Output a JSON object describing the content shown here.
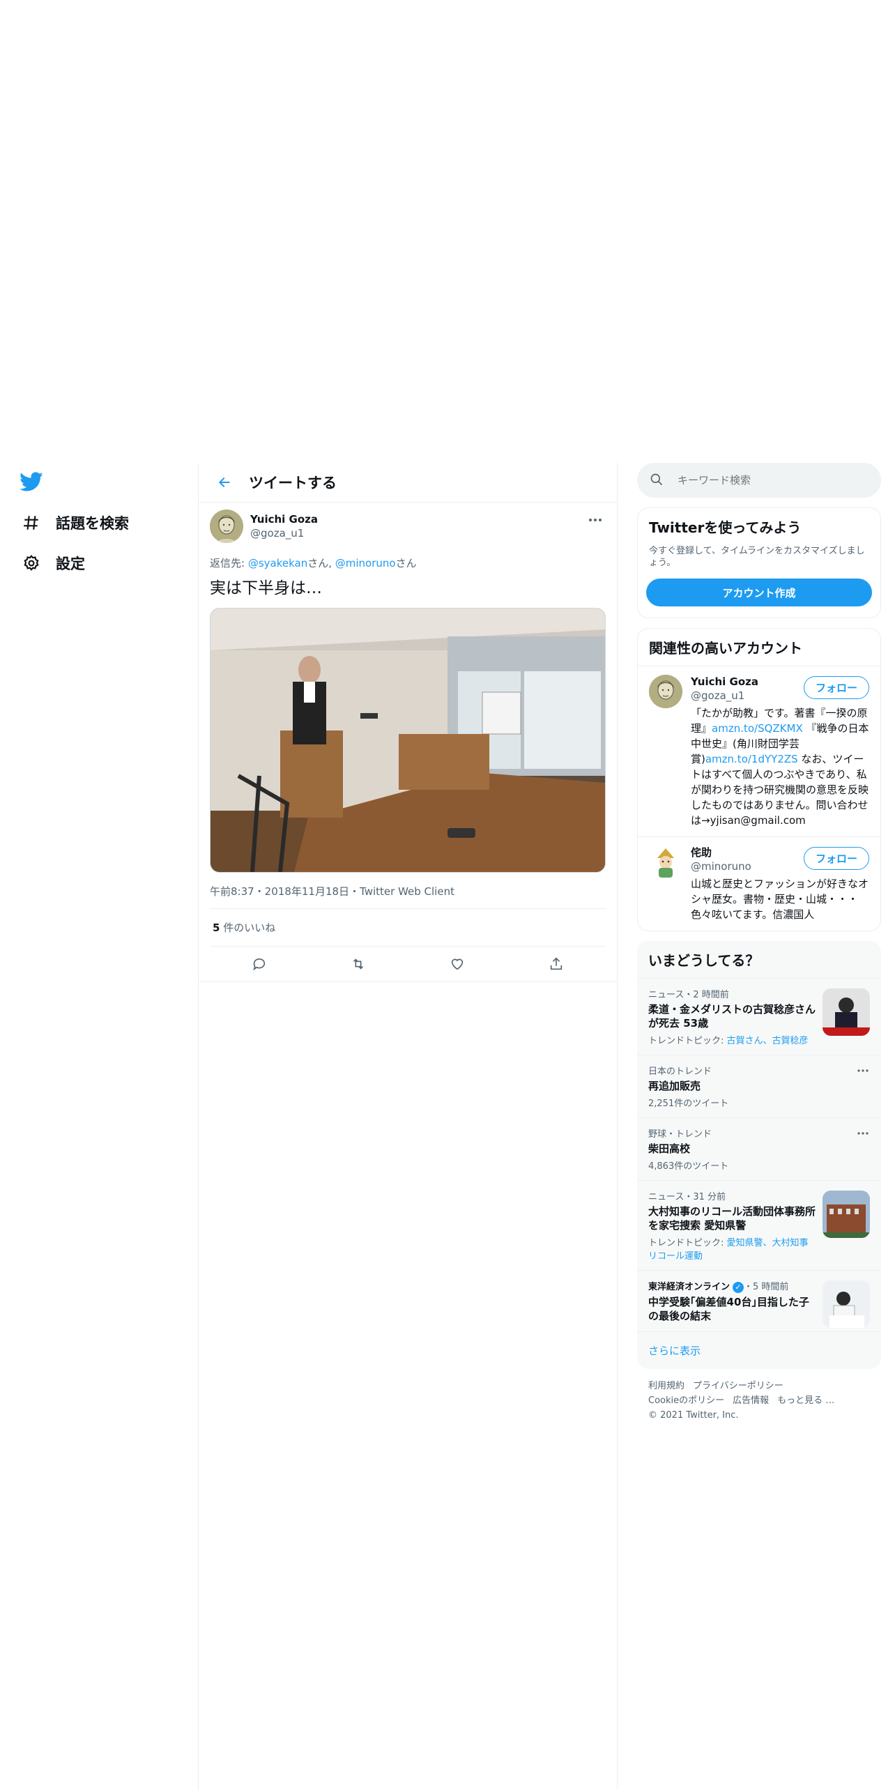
{
  "nav": {
    "logo_icon": "twitter-bird-icon",
    "items": [
      {
        "label": "話題を検索",
        "icon": "hashtag-icon"
      },
      {
        "label": "設定",
        "icon": "gear-icon"
      }
    ]
  },
  "header": {
    "title": "ツイートする"
  },
  "tweet": {
    "name": "Yuichi Goza",
    "handle": "@goza_u1",
    "reply_prefix": "返信先: ",
    "reply_user1": "@syakekan",
    "reply_mid": "さん, ",
    "reply_user2": "@minoruno",
    "reply_suffix": "さん",
    "text": "実は下半身は…",
    "meta": "午前8:37・2018年11月18日・Twitter Web Client",
    "likes_count": "5",
    "likes_label": " 件のいいね"
  },
  "search": {
    "placeholder": "キーワード検索"
  },
  "signup": {
    "title": "Twitterを使ってみよう",
    "subtitle": "今すぐ登録して、タイムラインをカスタマイズしましょう。",
    "button": "アカウント作成"
  },
  "related": {
    "title": "関連性の高いアカウント",
    "follow_label": "フォロー",
    "accounts": [
      {
        "name": "Yuichi Goza",
        "handle": "@goza_u1",
        "bio_1": "「たかが助教」です。著書『一揆の原理』",
        "bio_link1": "amzn.to/SQZKMX",
        "bio_2": " 『戦争の日本中世史』(角川財団学芸賞)",
        "bio_link2": "amzn.to/1dYY2ZS",
        "bio_3": " なお、ツイートはすべて個人のつぶやきであり、私が関わりを持つ研究機関の意思を反映したものではありません。問い合わせは→yjisan@gmail.com"
      },
      {
        "name": "侘助",
        "handle": "@minoruno",
        "bio": "山城と歴史とファッションが好きなオシャ歴女。書物・歴史・山城・・・色々呟いてます。信濃国人"
      }
    ]
  },
  "trends": {
    "title": "いまどうしてる？",
    "items": [
      {
        "meta": "ニュース・2 時間前",
        "title": "柔道・金メダリストの古賀稔彦さんが死去 53歳",
        "sub_prefix": "トレンドトピック: ",
        "sub_links": "古賀さん、古賀稔彦"
      },
      {
        "meta": "日本のトレンド",
        "title": "再追加販売",
        "sub": "2,251件のツイート"
      },
      {
        "meta": "野球・トレンド",
        "title": "柴田高校",
        "sub": "4,863件のツイート"
      },
      {
        "meta": "ニュース・31 分前",
        "title": "大村知事のリコール活動団体事務所を家宅捜索 愛知県警",
        "sub_prefix": "トレンドトピック: ",
        "sub_links": "愛知県警、大村知事リコール運動"
      },
      {
        "source": "東洋経済オンライン",
        "meta": "・5 時間前",
        "title": "中学受験｢偏差値40台｣目指した子の最後の結末"
      }
    ],
    "show_more": "さらに表示"
  },
  "footer": {
    "links": [
      "利用規約",
      "プライバシーポリシー",
      "Cookieのポリシー",
      "広告情報",
      "もっと見る …"
    ],
    "copyright": "© 2021 Twitter, Inc."
  },
  "colors": {
    "accent": "#1d9bf0",
    "text": "#0f1419",
    "muted": "#536471"
  }
}
